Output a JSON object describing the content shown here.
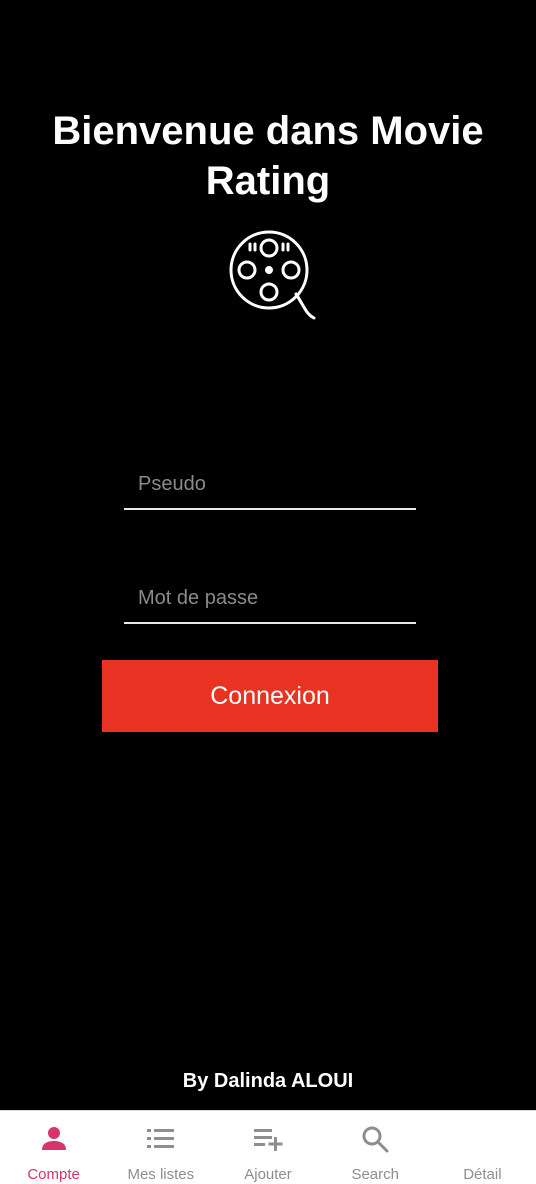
{
  "app": {
    "title": "Bienvenue dans Movie Rating",
    "author": "By Dalinda ALOUI"
  },
  "login": {
    "username_placeholder": "Pseudo",
    "username_value": "",
    "password_placeholder": "Mot de passe",
    "password_value": "",
    "submit_label": "Connexion"
  },
  "tabs": [
    {
      "label": "Compte",
      "icon": "person-icon",
      "active": true
    },
    {
      "label": "Mes listes",
      "icon": "list-icon",
      "active": false
    },
    {
      "label": "Ajouter",
      "icon": "playlist-add-icon",
      "active": false
    },
    {
      "label": "Search",
      "icon": "search-icon",
      "active": false
    },
    {
      "label": "Détail",
      "icon": "",
      "active": false
    }
  ],
  "colors": {
    "background": "#000000",
    "primary_button": "#e83323",
    "active_tab": "#d8336a",
    "inactive_tab": "#8e8e8e"
  }
}
